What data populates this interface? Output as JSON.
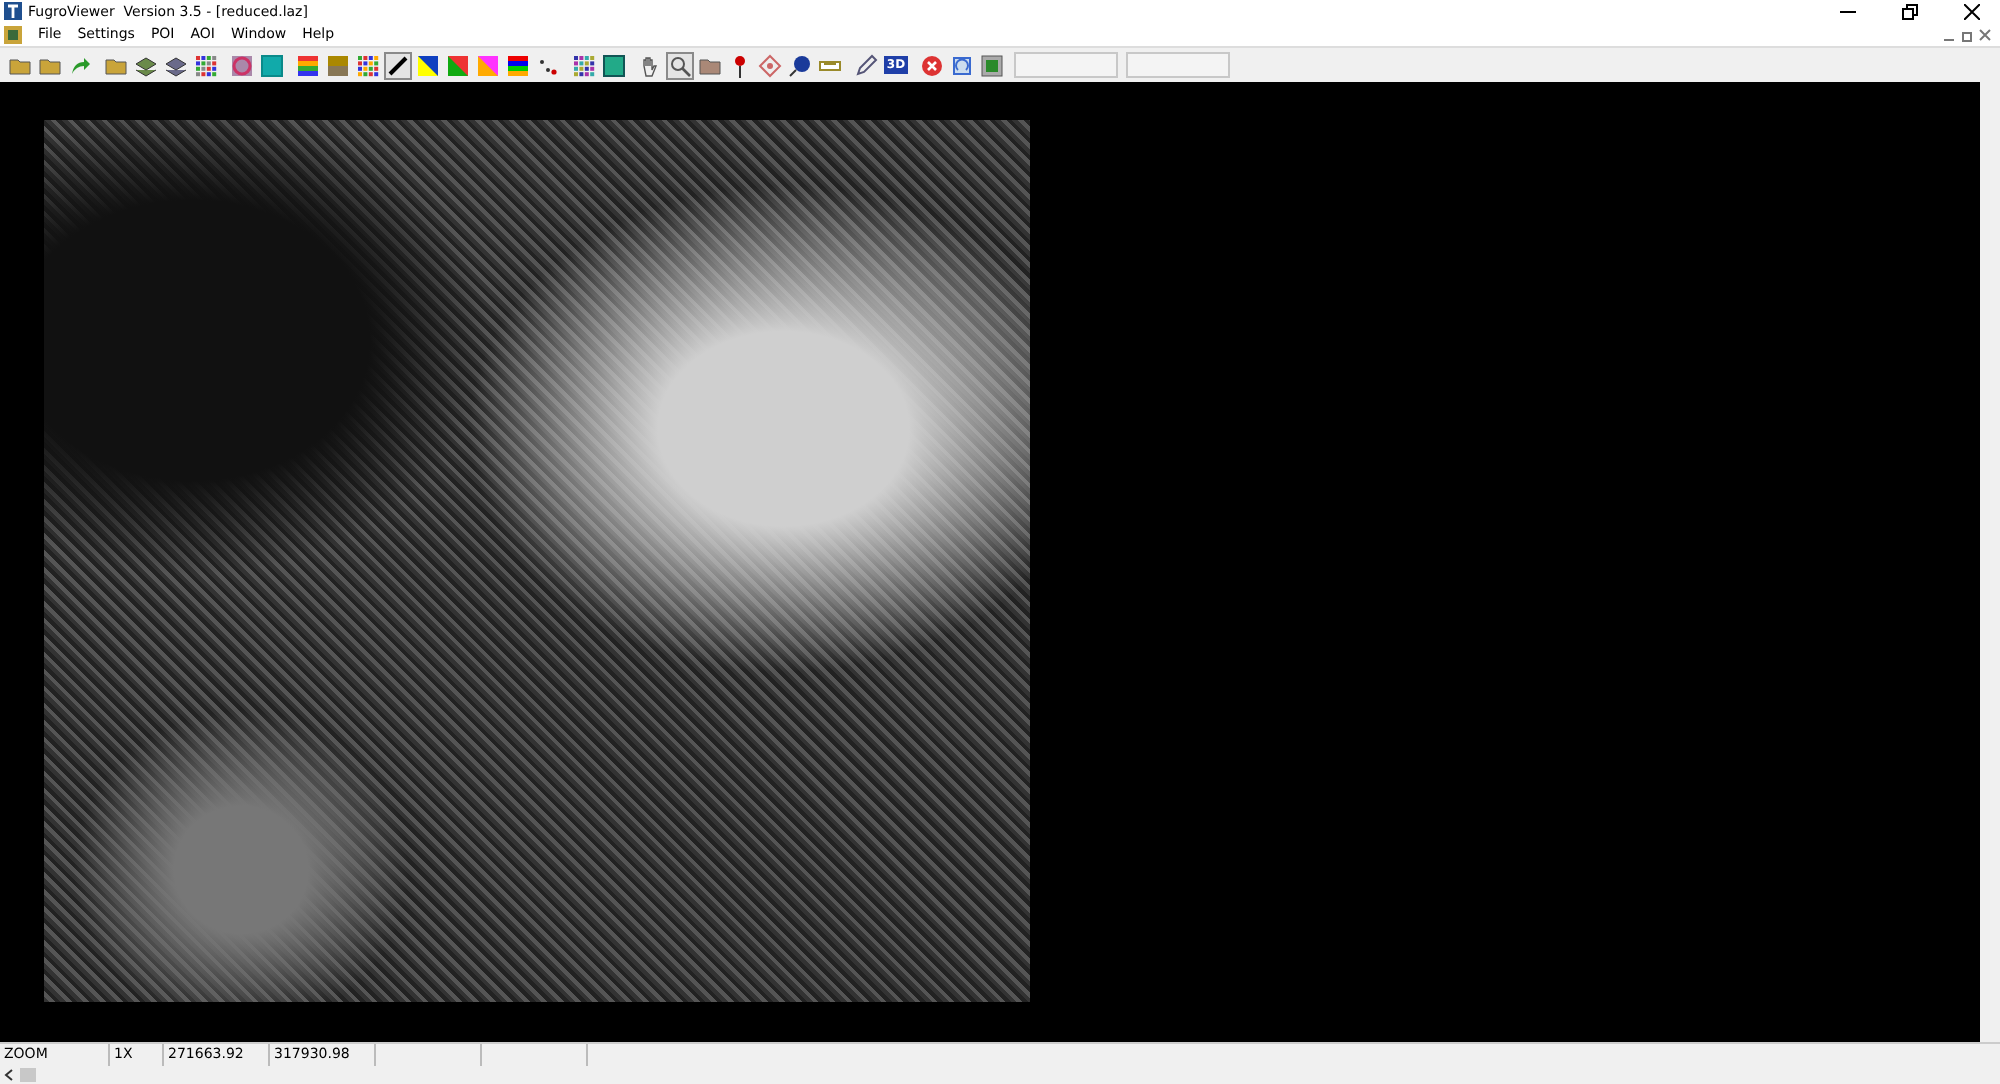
{
  "window": {
    "title": "FugroViewer  Version 3.5 - [reduced.laz]"
  },
  "menu": [
    "File",
    "Settings",
    "POI",
    "AOI",
    "Window",
    "Help"
  ],
  "toolbar": [
    {
      "selected": false
    },
    {
      "selected": false
    },
    {
      "selected": false
    },
    {
      "selected": false
    },
    {
      "selected": false
    },
    {
      "selected": false
    },
    {
      "selected": false
    },
    {
      "selected": false
    },
    {
      "selected": false
    },
    {
      "selected": false
    },
    {
      "selected": false
    },
    {
      "selected": false
    },
    {
      "selected": true
    },
    {
      "selected": false
    },
    {
      "selected": false
    },
    {
      "selected": false
    },
    {
      "selected": false
    },
    {
      "selected": false
    },
    {
      "selected": false
    },
    {
      "selected": false
    },
    {
      "selected": false
    },
    {
      "selected": true
    },
    {
      "selected": false
    },
    {
      "selected": false
    },
    {
      "selected": false
    },
    {
      "selected": false
    },
    {
      "selected": false
    },
    {
      "selected": false
    },
    {
      "selected": false,
      "label": "3D"
    },
    {
      "selected": false
    },
    {
      "selected": false
    },
    {
      "selected": false
    }
  ],
  "status_bar": [
    "ZOOM",
    "1X",
    "271663.92",
    "317930.98"
  ]
}
